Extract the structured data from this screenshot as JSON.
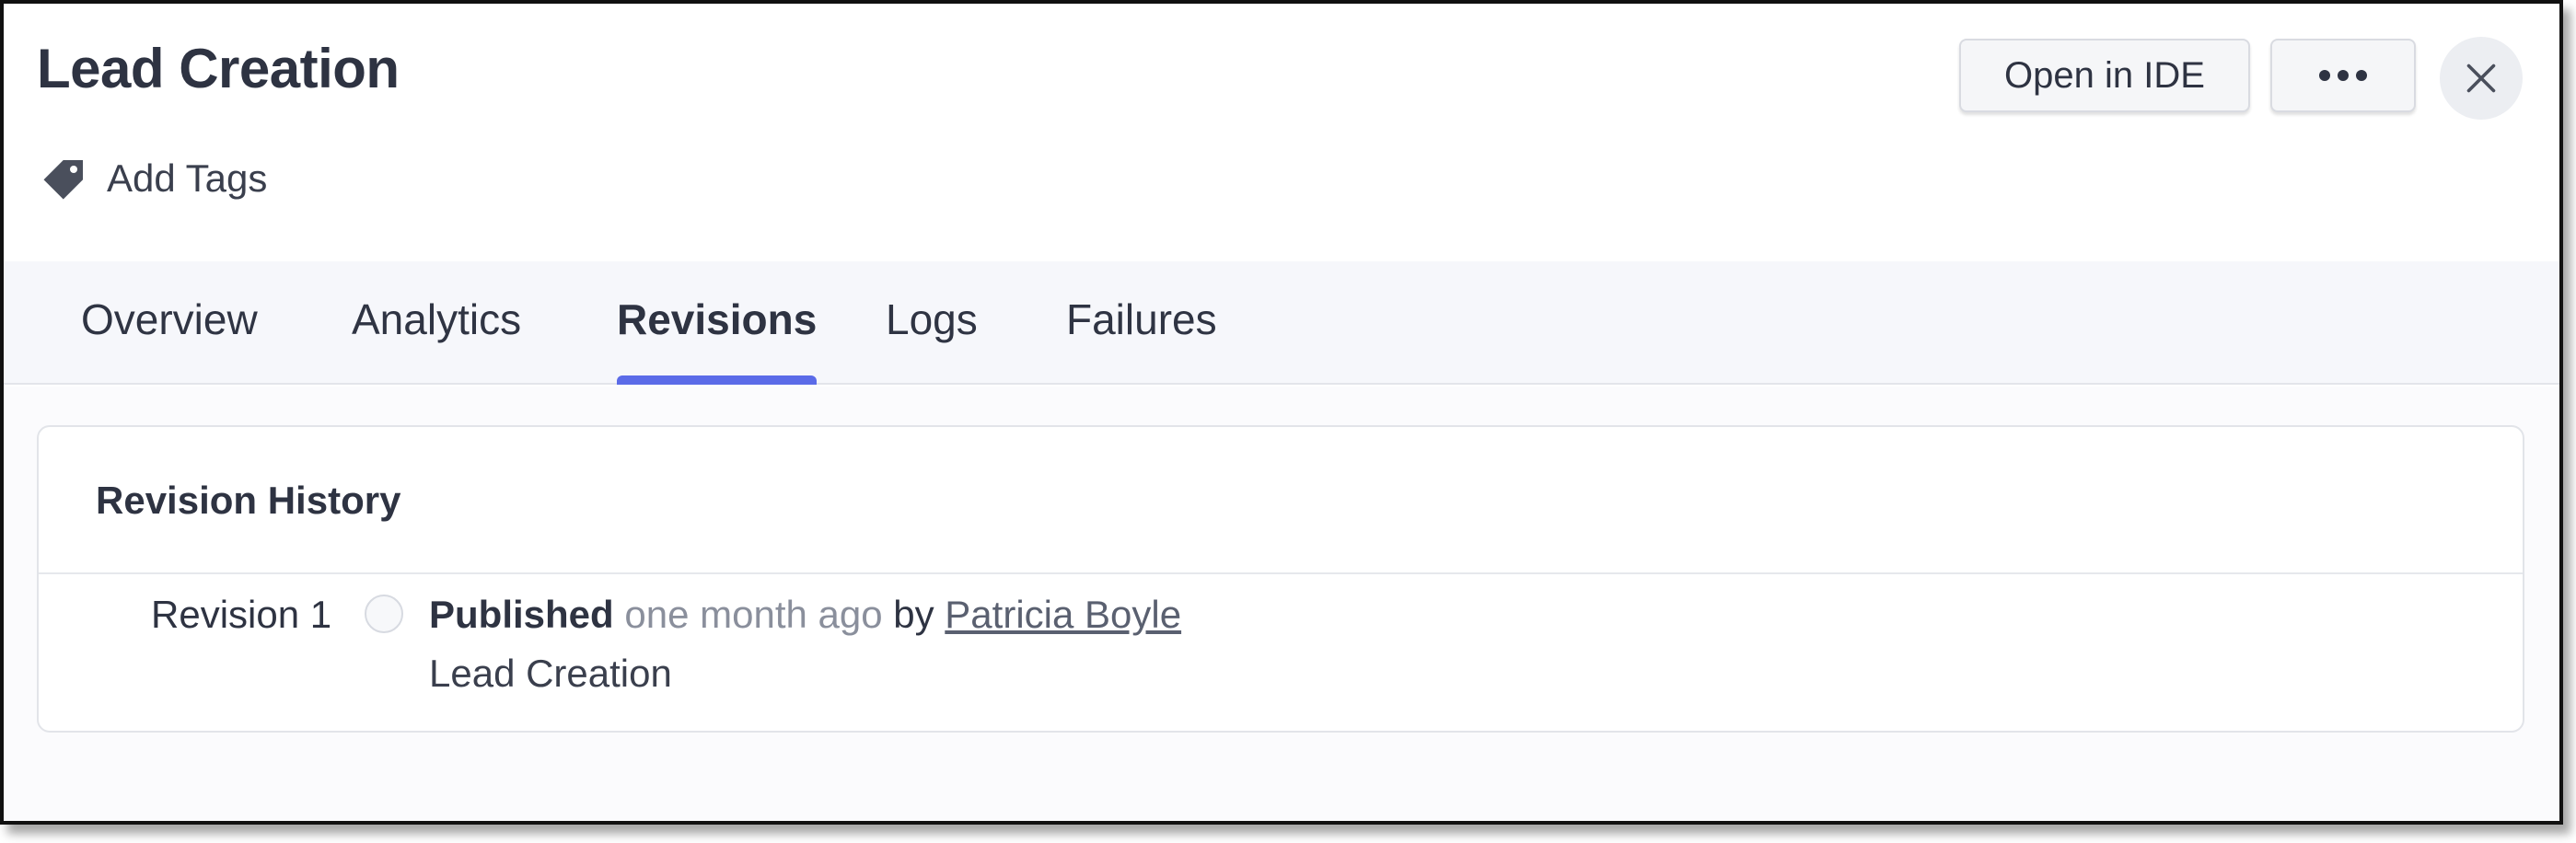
{
  "header": {
    "title": "Lead Creation",
    "add_tags_label": "Add Tags",
    "open_ide_label": "Open in IDE"
  },
  "tabs": [
    {
      "label": "Overview",
      "active": false
    },
    {
      "label": "Analytics",
      "active": false
    },
    {
      "label": "Revisions",
      "active": true
    },
    {
      "label": "Logs",
      "active": false
    },
    {
      "label": "Failures",
      "active": false
    }
  ],
  "revision_history": {
    "title": "Revision History",
    "revisions": [
      {
        "label": "Revision 1",
        "status": "Published",
        "time": "one month ago",
        "by_text": "by",
        "author": "Patricia Boyle",
        "name": "Lead Creation"
      }
    ]
  },
  "colors": {
    "accent": "#5b6be8",
    "tabbar_bg": "#f6f7fb",
    "muted_text": "#8a8f9c"
  },
  "icons": {
    "tag": "tag-icon",
    "more": "more-horizontal-icon",
    "close": "close-icon"
  }
}
